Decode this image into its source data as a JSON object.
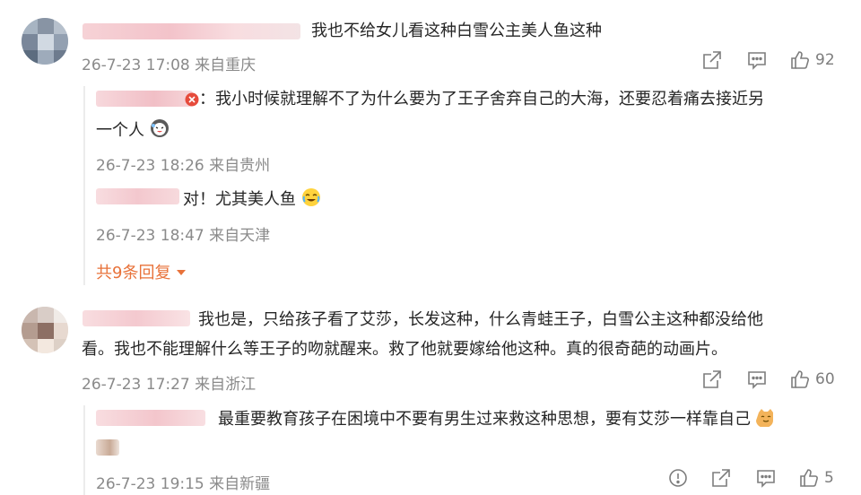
{
  "comments": [
    {
      "text": "我也不给女儿看这种白雪公主美人鱼这种",
      "meta": "26-7-23 17:08 来自重庆",
      "likes": "92",
      "replies": [
        {
          "line1": "：我小时候就理解不了为什么要为了王子舍弃自己的大海，还要忍着痛去接近另",
          "line2": "一个人",
          "meta": "26-7-23 18:26 来自贵州"
        },
        {
          "text": "对！尤其美人鱼",
          "meta": "26-7-23 18:47 来自天津"
        }
      ],
      "more_replies": "共9条回复"
    },
    {
      "line1": "我也是，只给孩子看了艾莎，长发这种，什么青蛙王子，白雪公主这种都没给他",
      "line2": "看。我也不能理解什么等王子的吻就醒来。救了他就要嫁给他这种。真的很奇葩的动画片。",
      "meta": "26-7-23 17:27 来自浙江",
      "likes": "60",
      "replies": [
        {
          "text": "最重要教育孩子在困境中不要有男生过来救这种思想，要有艾莎一样靠自己",
          "meta": "26-7-23 19:15 来自新疆",
          "likes": "5"
        }
      ]
    }
  ],
  "colors": {
    "accent": "#e8723a",
    "meta": "#8a8a8a",
    "text": "#262626"
  },
  "icons": [
    "share-icon",
    "comment-icon",
    "like-icon",
    "report-icon",
    "laughing-emoji",
    "crying-laugh-emoji",
    "cat-emoji",
    "caret-down-icon"
  ]
}
